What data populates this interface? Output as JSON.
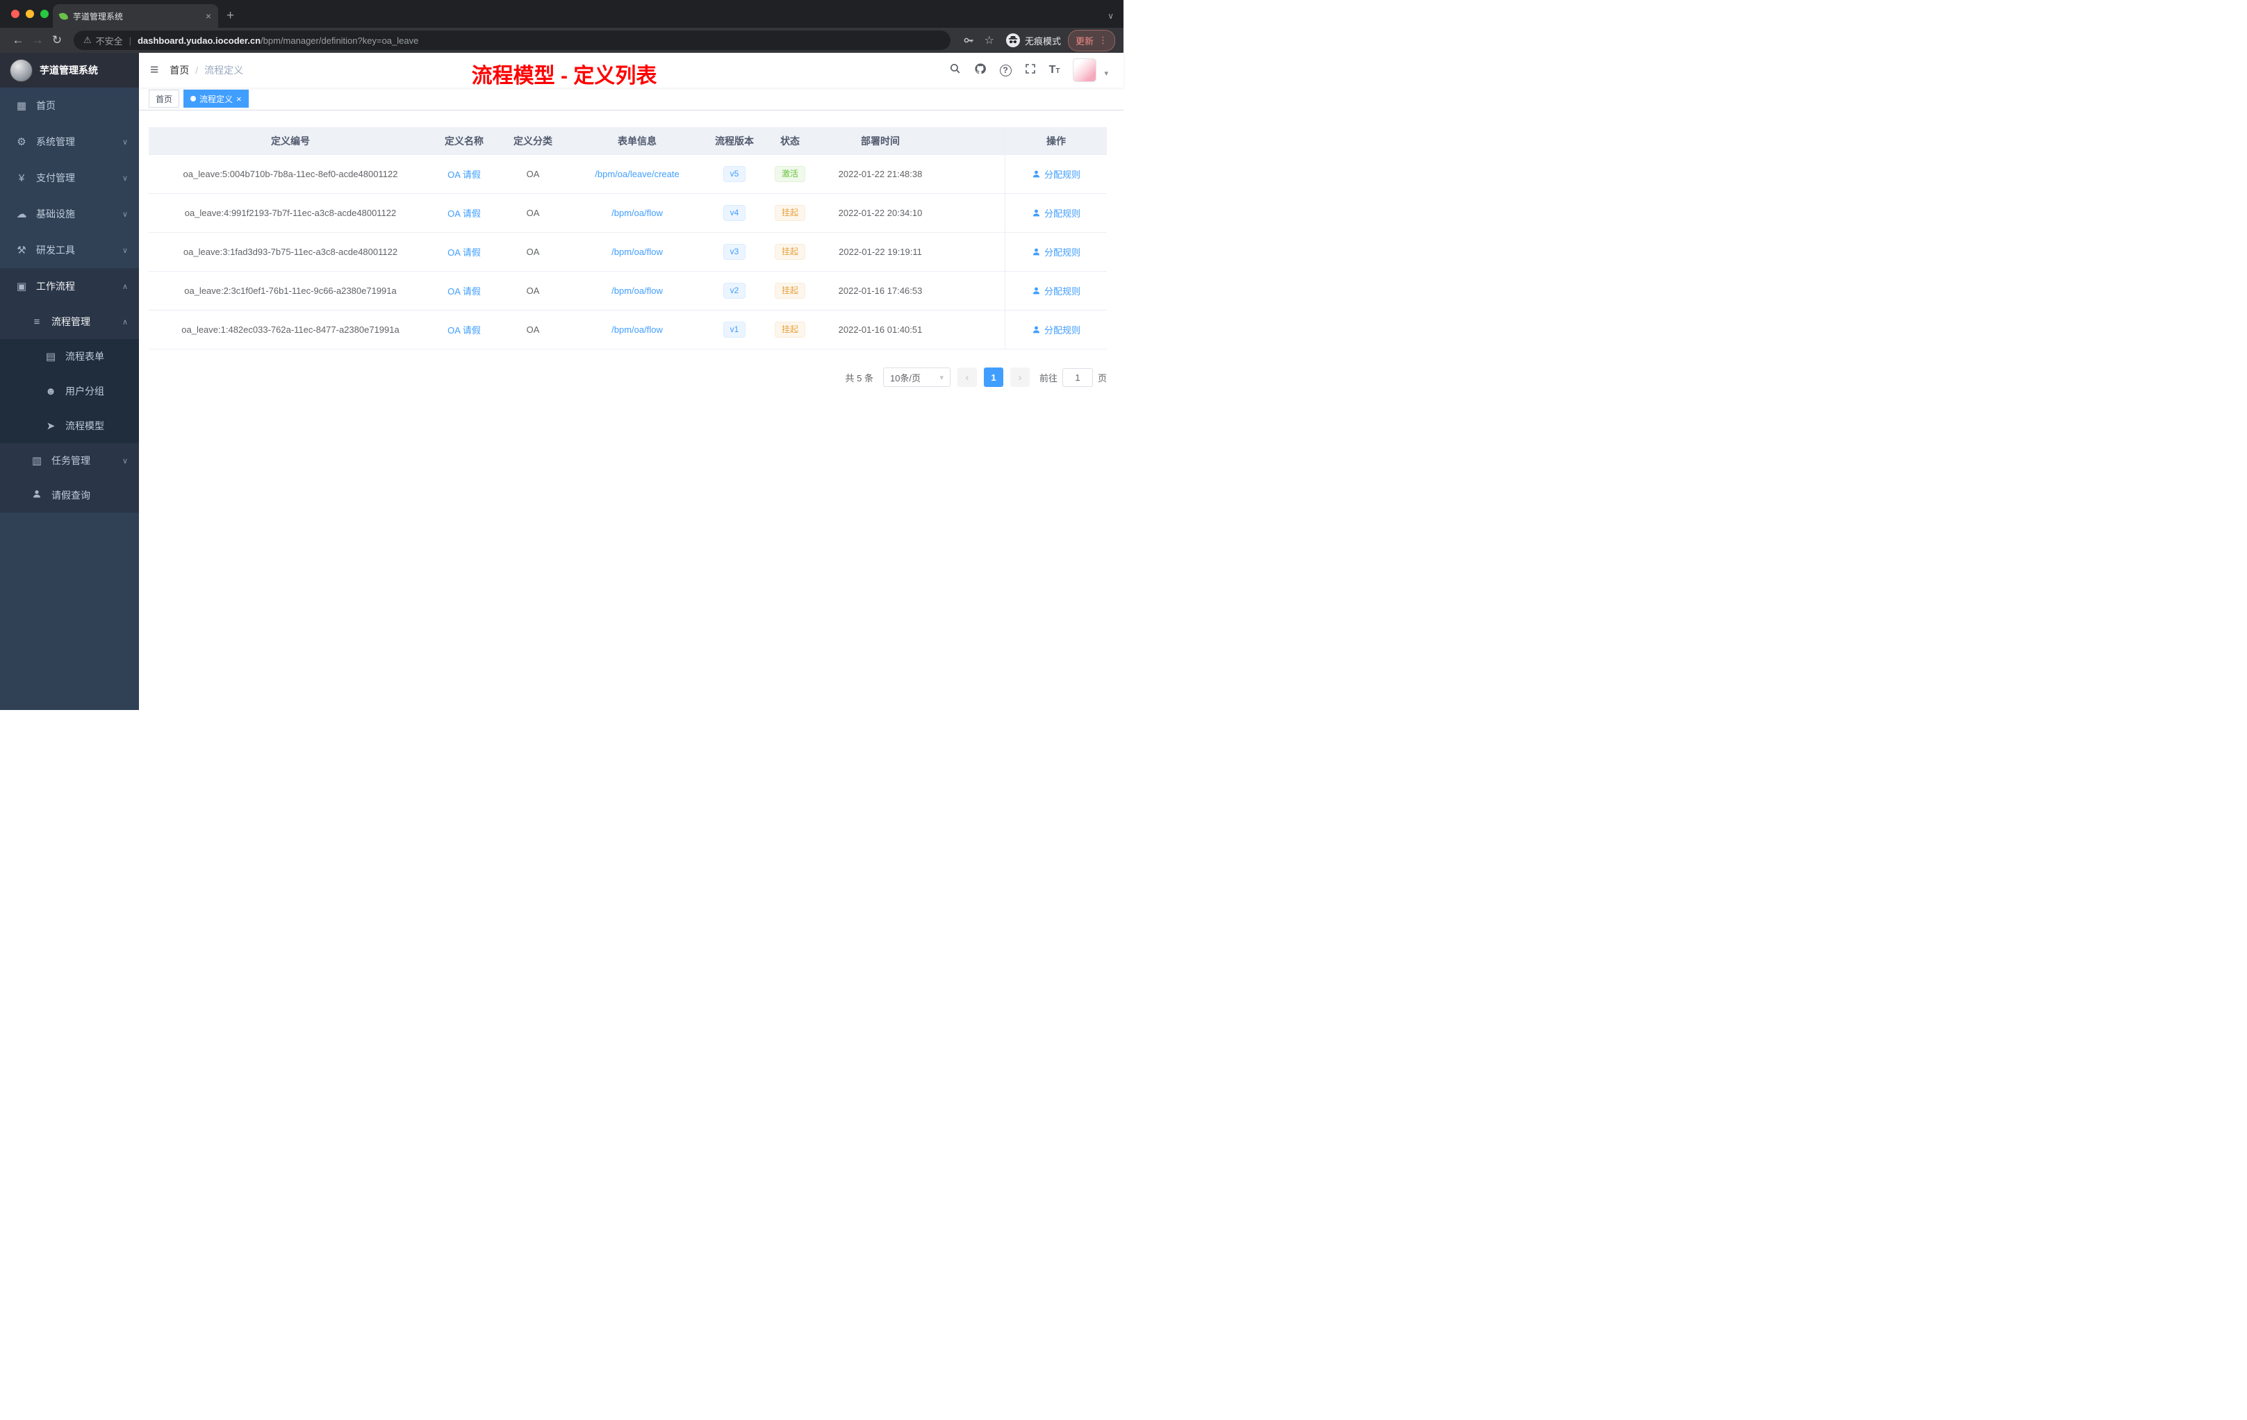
{
  "browser": {
    "tab_title": "芋道管理系统",
    "security_label": "不安全",
    "url_domain": "dashboard.yudao.iocoder.cn",
    "url_path": "/bpm/manager/definition?key=oa_leave",
    "incognito_label": "无痕模式",
    "update_label": "更新"
  },
  "icons": {
    "hamburger": "≡",
    "home": "▦",
    "system": "⚙",
    "payment": "¥",
    "infra": "☁",
    "devtool": "⚒",
    "workflow": "▣",
    "process": "≡",
    "form": "▤",
    "group": "☻",
    "model": "➤",
    "task": "▥",
    "chevron_down": "∨",
    "chevron_up": "∧",
    "caret_down": "▾",
    "back": "←",
    "forward": "→",
    "reload": "↻",
    "warning": "⚠",
    "star": "☆",
    "close": "×",
    "plus": "+",
    "prev": "‹",
    "next": "›",
    "dots": "⋮",
    "question": "?",
    "font_size": "T",
    "divider": "|"
  },
  "sidebar": {
    "app_title": "芋道管理系统",
    "items": [
      {
        "label": "首页"
      },
      {
        "label": "系统管理"
      },
      {
        "label": "支付管理"
      },
      {
        "label": "基础设施"
      },
      {
        "label": "研发工具"
      },
      {
        "label": "工作流程"
      },
      {
        "label": "流程管理"
      },
      {
        "label": "流程表单"
      },
      {
        "label": "用户分组"
      },
      {
        "label": "流程模型"
      },
      {
        "label": "任务管理"
      },
      {
        "label": "请假查询"
      }
    ]
  },
  "header": {
    "breadcrumb_home": "首页",
    "breadcrumb_separator": "/",
    "breadcrumb_current": "流程定义",
    "annotation": "流程模型 - 定义列表"
  },
  "tags": {
    "home": "首页",
    "active": "流程定义"
  },
  "table": {
    "columns": [
      "定义编号",
      "定义名称",
      "定义分类",
      "表单信息",
      "流程版本",
      "状态",
      "部署时间",
      "操作"
    ],
    "rows": [
      {
        "id": "oa_leave:5:004b710b-7b8a-11ec-8ef0-acde48001122",
        "name": "OA 请假",
        "category": "OA",
        "form": "/bpm/oa/leave/create",
        "version": "v5",
        "status": "激活",
        "time": "2022-01-22 21:48:38",
        "action": "分配规则"
      },
      {
        "id": "oa_leave:4:991f2193-7b7f-11ec-a3c8-acde48001122",
        "name": "OA 请假",
        "category": "OA",
        "form": "/bpm/oa/flow",
        "version": "v4",
        "status": "挂起",
        "time": "2022-01-22 20:34:10",
        "action": "分配规则"
      },
      {
        "id": "oa_leave:3:1fad3d93-7b75-11ec-a3c8-acde48001122",
        "name": "OA 请假",
        "category": "OA",
        "form": "/bpm/oa/flow",
        "version": "v3",
        "status": "挂起",
        "time": "2022-01-22 19:19:11",
        "action": "分配规则"
      },
      {
        "id": "oa_leave:2:3c1f0ef1-76b1-11ec-9c66-a2380e71991a",
        "name": "OA 请假",
        "category": "OA",
        "form": "/bpm/oa/flow",
        "version": "v2",
        "status": "挂起",
        "time": "2022-01-16 17:46:53",
        "action": "分配规则"
      },
      {
        "id": "oa_leave:1:482ec033-762a-11ec-8477-a2380e71991a",
        "name": "OA 请假",
        "category": "OA",
        "form": "/bpm/oa/flow",
        "version": "v1",
        "status": "挂起",
        "time": "2022-01-16 01:40:51",
        "action": "分配规则"
      }
    ]
  },
  "pagination": {
    "total": "共 5 条",
    "page_size": "10条/页",
    "page": "1",
    "goto_label": "前往",
    "goto_value": "1",
    "unit": "页"
  }
}
